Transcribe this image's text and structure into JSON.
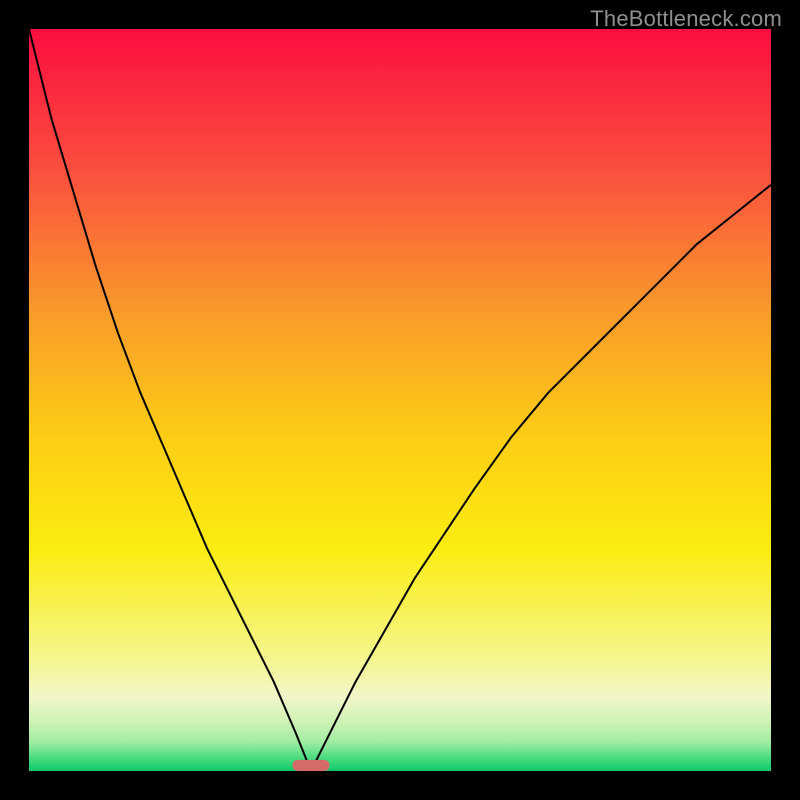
{
  "watermark": {
    "text": "TheBottleneck.com"
  },
  "chart_data": {
    "type": "line",
    "title": "",
    "xlabel": "",
    "ylabel": "",
    "xlim": [
      0,
      100
    ],
    "ylim": [
      0,
      100
    ],
    "x_optimum": 38,
    "curve_left": {
      "x": [
        0,
        3,
        6,
        9,
        12,
        15,
        18,
        21,
        24,
        27,
        30,
        33,
        36,
        38
      ],
      "y": [
        100,
        88,
        78,
        68,
        59,
        51,
        44,
        37,
        30,
        24,
        18,
        12,
        5,
        0
      ]
    },
    "curve_right": {
      "x": [
        38,
        41,
        44,
        48,
        52,
        56,
        60,
        65,
        70,
        75,
        80,
        85,
        90,
        95,
        100
      ],
      "y": [
        0,
        6,
        12,
        19,
        26,
        32,
        38,
        45,
        51,
        56,
        61,
        66,
        71,
        75,
        79
      ]
    },
    "marker": {
      "x": 38,
      "width_pct": 5,
      "height_pct": 1.5,
      "fill": "#d46a6a"
    },
    "bg_gradient": {
      "stops": [
        {
          "offset": 0.0,
          "color": "#fb0e3f"
        },
        {
          "offset": 0.18,
          "color": "#fb4b3f"
        },
        {
          "offset": 0.38,
          "color": "#f99a2b"
        },
        {
          "offset": 0.55,
          "color": "#fccd14"
        },
        {
          "offset": 0.7,
          "color": "#fbec11"
        },
        {
          "offset": 0.85,
          "color": "#f5f68f"
        },
        {
          "offset": 0.9,
          "color": "#f1f6c9"
        },
        {
          "offset": 0.93,
          "color": "#d4f2b7"
        },
        {
          "offset": 0.96,
          "color": "#a2eda3"
        },
        {
          "offset": 0.985,
          "color": "#41da7b"
        },
        {
          "offset": 1.0,
          "color": "#0fc96a"
        }
      ]
    }
  }
}
